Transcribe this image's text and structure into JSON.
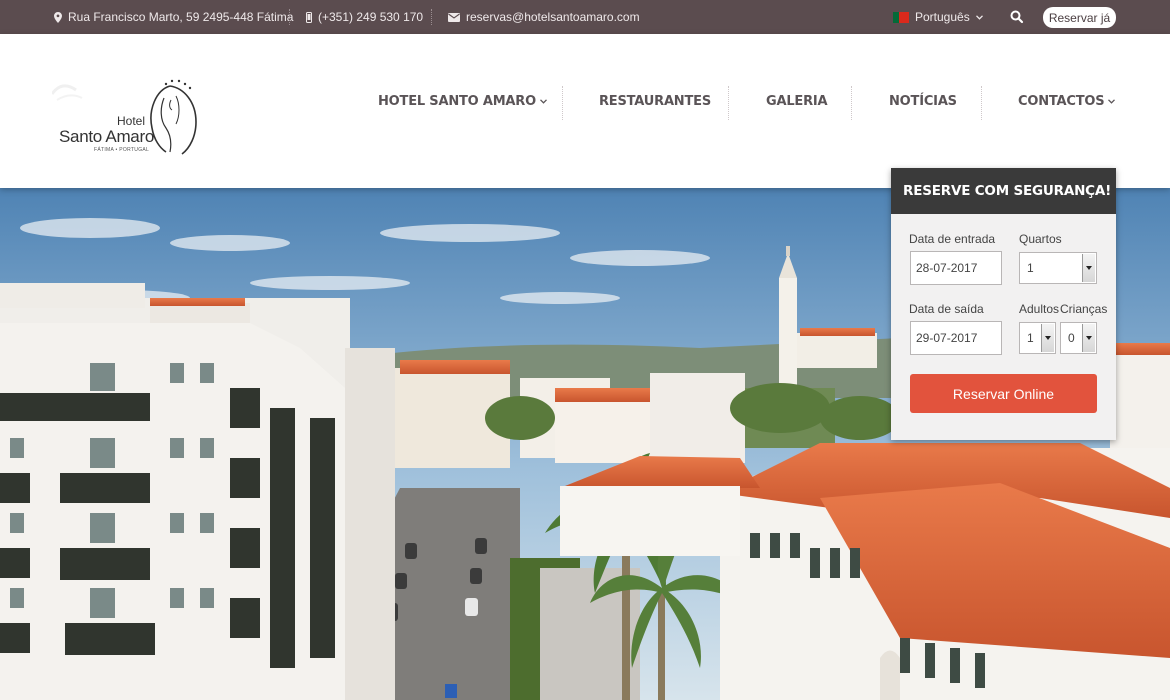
{
  "topbar": {
    "address": "Rua Francisco Marto, 59 2495-448 Fátima",
    "phone": "(+351) 249 530 170",
    "email": "reservas@hotelsantoamaro.com",
    "language": "Português",
    "book_now": "Reservar já"
  },
  "logo": {
    "line1": "Hotel",
    "line2": "Santo Amaro",
    "line3": "FÁTIMA • PORTUGAL"
  },
  "nav": [
    {
      "label": "HOTEL SANTO AMARO",
      "has_dropdown": true
    },
    {
      "label": "RESTAURANTES",
      "has_dropdown": false
    },
    {
      "label": "GALERIA",
      "has_dropdown": false
    },
    {
      "label": "NOTÍCIAS",
      "has_dropdown": false
    },
    {
      "label": "CONTACTOS",
      "has_dropdown": true
    }
  ],
  "booking": {
    "title": "RESERVE COM SEGURANÇA!",
    "checkin_label": "Data de entrada",
    "checkin_value": "28-07-2017",
    "rooms_label": "Quartos",
    "rooms_value": "1",
    "checkout_label": "Data de saída",
    "checkout_value": "29-07-2017",
    "adults_label": "Adultos",
    "adults_value": "1",
    "children_label": "Crianças",
    "children_value": "0",
    "submit": "Reservar Online"
  },
  "colors": {
    "topbar_bg": "#5b4c4f",
    "accent_button": "#e2533d",
    "booking_title_bg": "#3a3a3a",
    "nav_text": "#5a5457"
  },
  "icons": [
    "map-marker-icon",
    "phone-icon",
    "envelope-icon",
    "portugal-flag-icon",
    "chevron-down-icon",
    "search-icon"
  ]
}
